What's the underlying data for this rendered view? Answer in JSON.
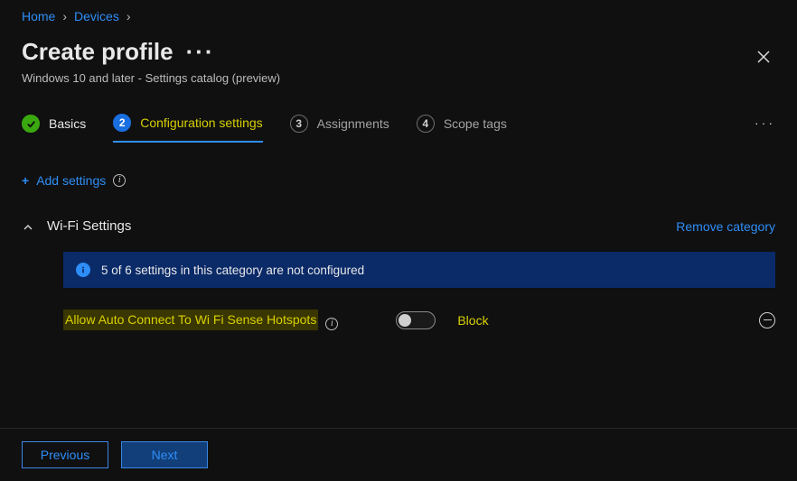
{
  "breadcrumb": {
    "items": [
      "Home",
      "Devices"
    ]
  },
  "header": {
    "title": "Create profile",
    "subtitle": "Windows 10 and later - Settings catalog (preview)"
  },
  "steps": {
    "items": [
      {
        "label": "Basics"
      },
      {
        "label": "Configuration settings",
        "num": "2"
      },
      {
        "label": "Assignments",
        "num": "3"
      },
      {
        "label": "Scope tags",
        "num": "4"
      }
    ]
  },
  "actions": {
    "add_settings": "Add settings"
  },
  "category": {
    "title": "Wi-Fi Settings",
    "remove_label": "Remove category",
    "info_text": "5 of 6 settings in this category are not configured",
    "setting": {
      "label": "Allow Auto Connect To Wi Fi Sense Hotspots",
      "value_label": "Block",
      "value": false
    }
  },
  "footer": {
    "previous": "Previous",
    "next": "Next"
  }
}
